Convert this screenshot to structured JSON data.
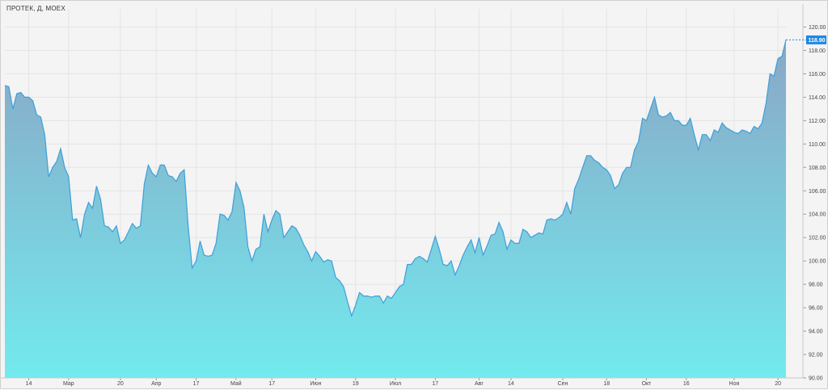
{
  "chart_data": {
    "type": "area",
    "title": "ПРОТЕК, Д, MOEX",
    "last_price_label": "118.90",
    "last_value": 118.9,
    "ylim": [
      90,
      121
    ],
    "y_ticks": [
      {
        "value": 120,
        "label": "120.00"
      },
      {
        "value": 118,
        "label": "118.00"
      },
      {
        "value": 116,
        "label": "116.00"
      },
      {
        "value": 114,
        "label": "114.00"
      },
      {
        "value": 112,
        "label": "112.00"
      },
      {
        "value": 110,
        "label": "110.00"
      },
      {
        "value": 108,
        "label": "108.00"
      },
      {
        "value": 106,
        "label": "106.00"
      },
      {
        "value": 104,
        "label": "104.00"
      },
      {
        "value": 102,
        "label": "102.00"
      },
      {
        "value": 100,
        "label": "100.00"
      },
      {
        "value": 98,
        "label": "98.00"
      },
      {
        "value": 96,
        "label": "96.00"
      },
      {
        "value": 94,
        "label": "94.00"
      },
      {
        "value": 92,
        "label": "92.00"
      },
      {
        "value": 90,
        "label": "90.00"
      }
    ],
    "x_ticks": [
      {
        "index": 6,
        "label": "14"
      },
      {
        "index": 16,
        "label": "Мар"
      },
      {
        "index": 29,
        "label": "20"
      },
      {
        "index": 38,
        "label": "Апр"
      },
      {
        "index": 48,
        "label": "17"
      },
      {
        "index": 58,
        "label": "Май"
      },
      {
        "index": 67,
        "label": "17"
      },
      {
        "index": 78,
        "label": "Июн"
      },
      {
        "index": 88,
        "label": "19"
      },
      {
        "index": 98,
        "label": "Июл"
      },
      {
        "index": 108,
        "label": "17"
      },
      {
        "index": 119,
        "label": "Авг"
      },
      {
        "index": 127,
        "label": "14"
      },
      {
        "index": 140,
        "label": "Сен"
      },
      {
        "index": 151,
        "label": "18"
      },
      {
        "index": 161,
        "label": "Окт"
      },
      {
        "index": 171,
        "label": "16"
      },
      {
        "index": 183,
        "label": "Ноя"
      },
      {
        "index": 194,
        "label": "20"
      }
    ],
    "values": [
      115.0,
      114.9,
      113.0,
      114.3,
      114.4,
      114.0,
      114.0,
      113.7,
      112.5,
      112.3,
      110.8,
      107.2,
      108.0,
      108.5,
      109.6,
      108.0,
      107.2,
      103.5,
      103.6,
      102.0,
      104.0,
      105.0,
      104.5,
      106.4,
      105.3,
      103.0,
      102.9,
      102.5,
      103.0,
      101.5,
      101.8,
      102.5,
      103.2,
      102.8,
      103.0,
      106.6,
      108.2,
      107.5,
      107.2,
      108.2,
      108.2,
      107.3,
      107.2,
      106.8,
      107.5,
      107.8,
      103.0,
      99.4,
      100.0,
      101.7,
      100.5,
      100.4,
      100.5,
      101.5,
      104.0,
      103.9,
      103.5,
      104.2,
      106.7,
      106.0,
      104.6,
      101.2,
      100.0,
      101.0,
      101.2,
      104.0,
      102.5,
      103.5,
      104.3,
      104.0,
      102.0,
      102.5,
      103.0,
      102.8,
      102.2,
      101.4,
      100.8,
      100.0,
      100.8,
      100.4,
      99.9,
      100.1,
      100.0,
      98.6,
      98.3,
      97.8,
      96.5,
      95.3,
      96.2,
      97.3,
      97.0,
      97.0,
      96.9,
      97.0,
      97.0,
      96.4,
      97.0,
      96.8,
      97.3,
      97.8,
      98.0,
      99.7,
      99.7,
      100.2,
      100.4,
      100.2,
      99.9,
      101.0,
      102.1,
      101.0,
      99.7,
      99.6,
      100.0,
      98.8,
      99.6,
      100.5,
      101.2,
      101.8,
      100.7,
      102.0,
      100.5,
      101.3,
      102.2,
      102.3,
      103.3,
      102.5,
      101.0,
      101.8,
      101.5,
      101.5,
      102.7,
      102.5,
      102.0,
      102.2,
      102.4,
      102.3,
      103.5,
      103.6,
      103.5,
      103.7,
      104.0,
      105.0,
      104.0,
      106.2,
      107.0,
      108.0,
      109.0,
      109.0,
      108.6,
      108.4,
      108.0,
      107.8,
      107.3,
      106.2,
      106.5,
      107.5,
      108.0,
      108.0,
      109.5,
      110.2,
      112.2,
      112.0,
      113.0,
      114.0,
      112.5,
      112.3,
      112.4,
      112.7,
      112.0,
      112.0,
      111.6,
      111.6,
      112.2,
      110.8,
      109.5,
      110.8,
      110.8,
      110.3,
      111.2,
      111.0,
      111.8,
      111.4,
      111.2,
      111.0,
      110.9,
      111.2,
      111.1,
      110.9,
      111.5,
      111.3,
      111.8,
      113.5,
      116.0,
      115.8,
      117.3,
      117.5,
      118.9
    ],
    "colors": {
      "line": "#3d9fd9",
      "fill_top": "#8aa6c6",
      "fill_bottom": "#72eaee",
      "price_tag": "#1e88e5",
      "grid": "#e4e4e4"
    }
  }
}
